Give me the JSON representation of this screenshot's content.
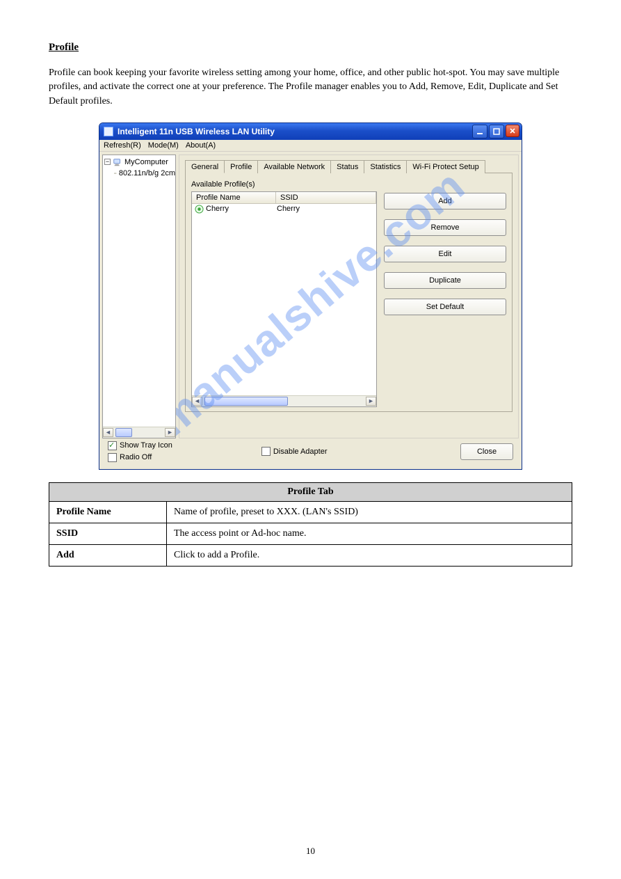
{
  "heading": "Profile",
  "intro": "Profile can book keeping your favorite wireless setting among your home, office, and other public hot-spot. You may save multiple profiles, and activate the correct one at your preference. The Profile manager enables you to Add, Remove, Edit, Duplicate and Set Default profiles.",
  "window": {
    "title": "Intelligent 11n USB Wireless LAN Utility",
    "menu": {
      "refresh": "Refresh(R)",
      "mode": "Mode(M)",
      "about": "About(A)"
    },
    "tree": {
      "root": "MyComputer",
      "child": "802.11n/b/g 2cm"
    },
    "tabs": {
      "general": "General",
      "profile": "Profile",
      "available_network": "Available Network",
      "status": "Status",
      "statistics": "Statistics",
      "wps": "Wi-Fi Protect Setup"
    },
    "profile_panel": {
      "caption": "Available Profile(s)",
      "col_profile_name": "Profile Name",
      "col_ssid": "SSID",
      "rows": [
        {
          "name": "Cherry",
          "ssid": "Cherry"
        }
      ],
      "buttons": {
        "add": "Add",
        "remove": "Remove",
        "edit": "Edit",
        "duplicate": "Duplicate",
        "set_default": "Set Default"
      }
    },
    "footer": {
      "show_tray_icon": "Show Tray Icon",
      "radio_off": "Radio Off",
      "disable_adapter": "Disable Adapter",
      "close": "Close"
    }
  },
  "table": {
    "header": "Profile Tab",
    "rows": [
      {
        "k": "Profile Name",
        "v": "Name of profile, preset to XXX. (LAN's SSID)"
      },
      {
        "k": "SSID",
        "v": "The access point or Ad-hoc name."
      },
      {
        "k": "Add",
        "v": "Click to add a Profile."
      }
    ]
  },
  "page_number": "10",
  "watermark": "manualshive.com"
}
